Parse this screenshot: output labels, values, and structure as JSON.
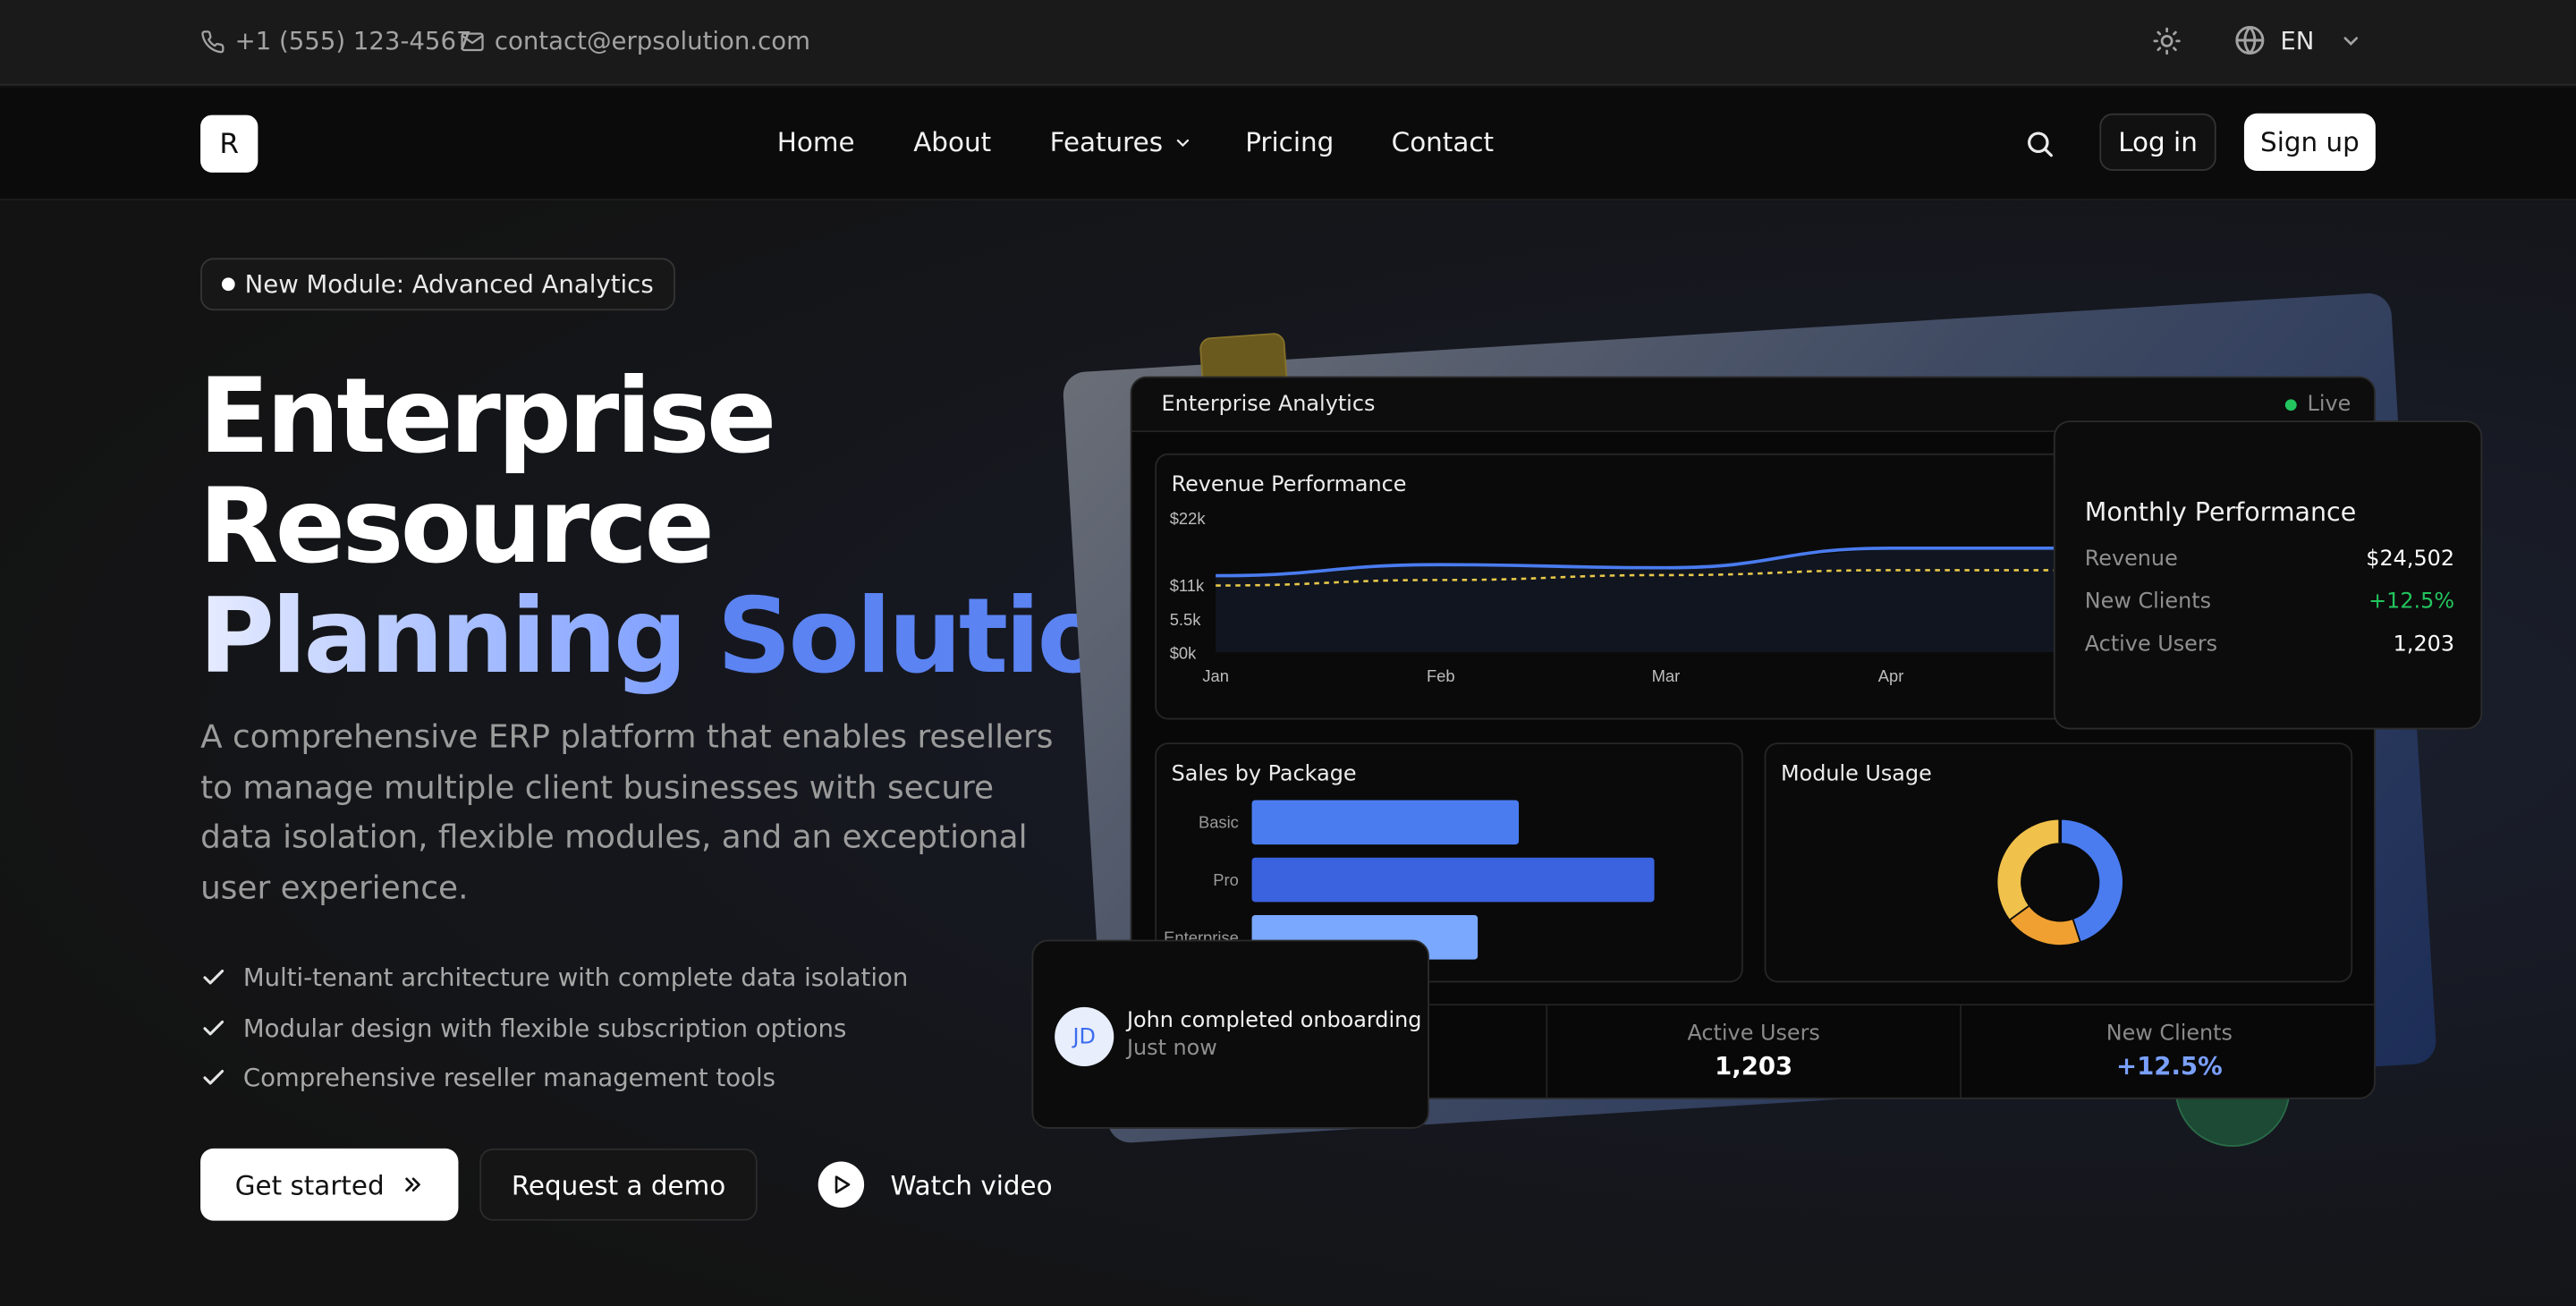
{
  "topbar": {
    "phone": "+1 (555) 123-4567",
    "email": "contact@erpsolution.com",
    "language": "EN"
  },
  "nav": {
    "logo_letter": "R",
    "links": [
      "Home",
      "About",
      "Features",
      "Pricing",
      "Contact"
    ],
    "login": "Log in",
    "signup": "Sign up"
  },
  "hero": {
    "badge": "New Module: Advanced Analytics",
    "title_line1": "Enterprise",
    "title_line2": "Resource",
    "title_line3a": "Planning",
    "title_line3b": "Solution",
    "description": "A comprehensive ERP platform that enables resellers to manage multiple client businesses with secure data isolation, flexible modules, and an exceptional user experience.",
    "features": [
      "Multi-tenant architecture with complete data isolation",
      "Modular design with flexible subscription options",
      "Comprehensive reseller management tools"
    ],
    "cta_start": "Get started",
    "cta_demo": "Request a demo",
    "cta_watch": "Watch video"
  },
  "dashboard": {
    "title": "Enterprise Analytics",
    "status": "Live",
    "revenue_title": "Revenue Performance",
    "sales_title": "Sales by Package",
    "module_title": "Module Usage",
    "stats": [
      {
        "label": "Active Users",
        "value": "1,203"
      },
      {
        "label": "New Clients",
        "value": "+12.5%"
      }
    ]
  },
  "monthly": {
    "title": "Monthly Performance",
    "rows": [
      {
        "label": "Revenue",
        "value": "$24,502"
      },
      {
        "label": "New Clients",
        "value": "+12.5%"
      },
      {
        "label": "Active Users",
        "value": "1,203"
      }
    ]
  },
  "notification": {
    "initials": "JD",
    "text": "John completed onboarding",
    "time": "Just now"
  },
  "colors": {
    "accent": "#4a7cf0",
    "positive": "#22c55e",
    "yellow": "#f0c14b",
    "orange": "#f0a030"
  },
  "chart_data": [
    {
      "type": "line",
      "title": "Revenue Performance",
      "categories": [
        "Jan",
        "Feb",
        "Mar",
        "Apr"
      ],
      "y_ticks": [
        "$0k",
        "5.5k",
        "$11k",
        "$22k"
      ],
      "ylim": [
        0,
        22
      ],
      "series": [
        {
          "values": [
            12.5,
            14.3,
            13.8,
            17.0
          ],
          "color": "#4a7cf0",
          "style": "solid"
        },
        {
          "values": [
            10.9,
            11.8,
            12.6,
            13.4
          ],
          "color": "#e8c84a",
          "style": "dashed"
        }
      ]
    },
    {
      "type": "bar",
      "title": "Sales by Package",
      "orientation": "horizontal",
      "categories": [
        "Basic",
        "Pro",
        "Enterprise"
      ],
      "values": [
        65,
        98,
        55
      ],
      "colors": [
        "#4a7cf0",
        "#3b63e0",
        "#7aa8ff"
      ]
    },
    {
      "type": "pie",
      "title": "Module Usage",
      "donut": true,
      "values": [
        45,
        20,
        35
      ],
      "colors": [
        "#4a7cf0",
        "#f0a030",
        "#f0c14b"
      ]
    }
  ]
}
